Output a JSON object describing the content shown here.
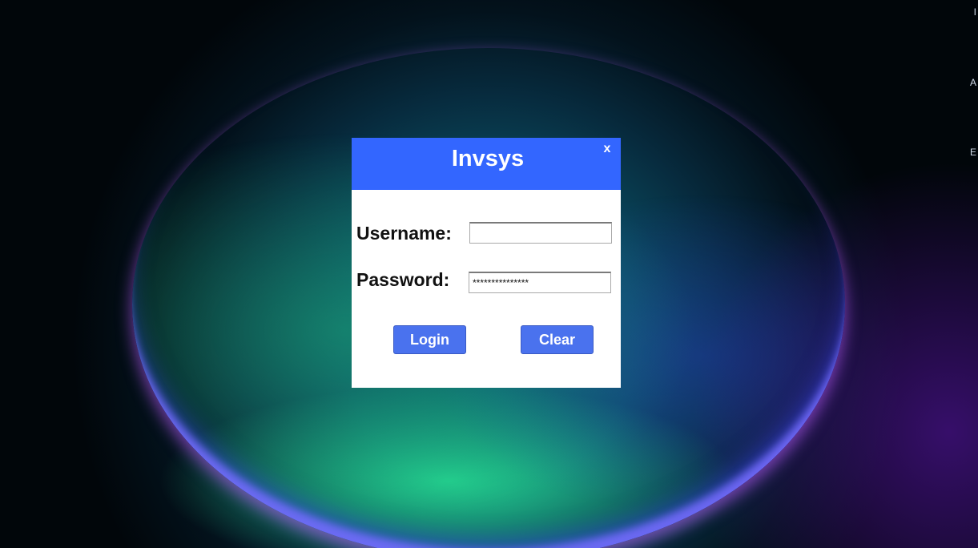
{
  "dialog": {
    "title": "Invsys",
    "close_label": "x",
    "username_label": "Username:",
    "username_value": "",
    "password_label": "Password:",
    "password_value": "***************",
    "login_label": "Login",
    "clear_label": "Clear"
  },
  "desktop": {
    "edge_labels": [
      "I",
      "A",
      "E"
    ]
  },
  "colors": {
    "header": "#3366ff",
    "button": "#4a72ee",
    "dialog_bg": "#ffffff"
  }
}
